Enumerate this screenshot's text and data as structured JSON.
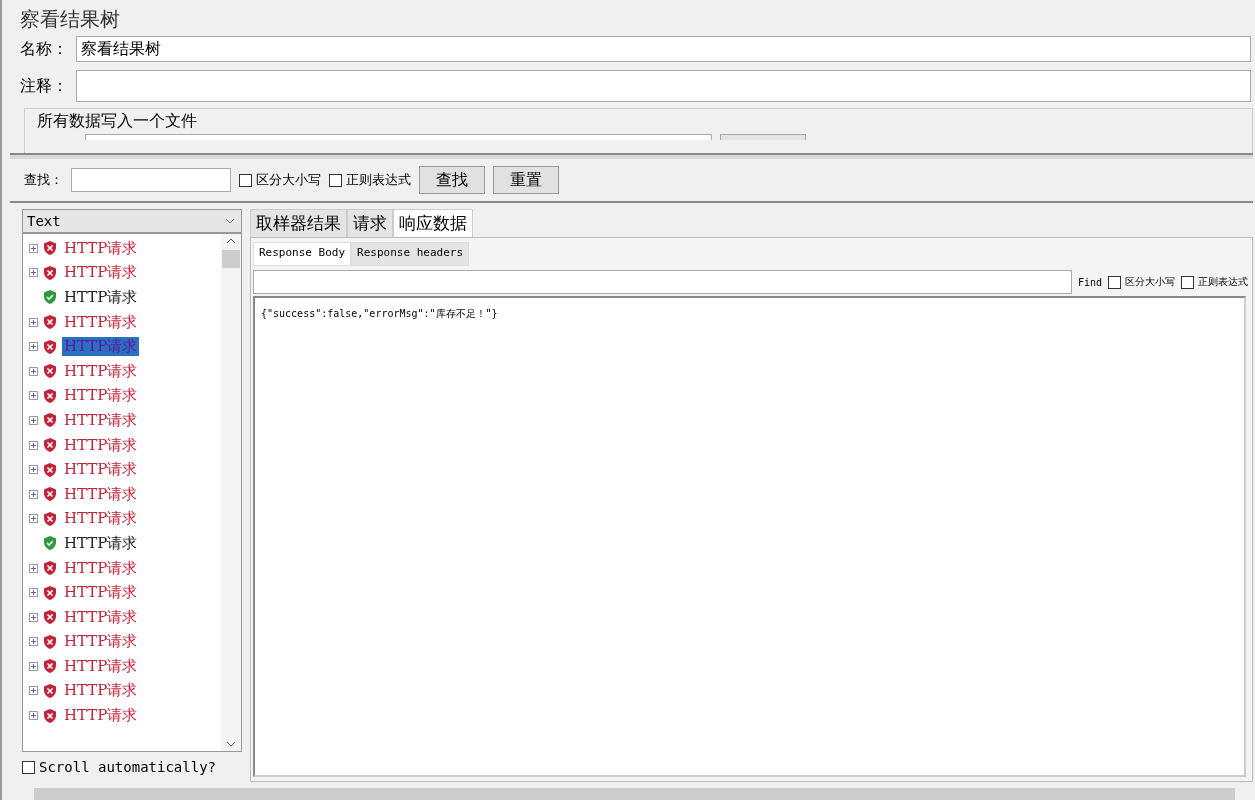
{
  "title": "察看结果树",
  "name_field": {
    "label": "名称：",
    "value": "察看结果树"
  },
  "comment_field": {
    "label": "注释："
  },
  "file_group": {
    "title": "所有数据写入一个文件"
  },
  "search_bar": {
    "label": "查找：",
    "options": [
      {
        "label": "区分大小写",
        "checked": false
      },
      {
        "label": "正则表达式",
        "checked": false
      }
    ],
    "buttons": [
      "查找",
      "重置"
    ]
  },
  "renderer": {
    "value": "Text"
  },
  "tree": [
    {
      "label": "HTTP请求",
      "success": false,
      "selected": false
    },
    {
      "label": "HTTP请求",
      "success": false,
      "selected": false
    },
    {
      "label": "HTTP请求",
      "success": true,
      "selected": false
    },
    {
      "label": "HTTP请求",
      "success": false,
      "selected": false
    },
    {
      "label": "HTTP请求",
      "success": false,
      "selected": true
    },
    {
      "label": "HTTP请求",
      "success": false,
      "selected": false
    },
    {
      "label": "HTTP请求",
      "success": false,
      "selected": false
    },
    {
      "label": "HTTP请求",
      "success": false,
      "selected": false
    },
    {
      "label": "HTTP请求",
      "success": false,
      "selected": false
    },
    {
      "label": "HTTP请求",
      "success": false,
      "selected": false
    },
    {
      "label": "HTTP请求",
      "success": false,
      "selected": false
    },
    {
      "label": "HTTP请求",
      "success": false,
      "selected": false
    },
    {
      "label": "HTTP请求",
      "success": true,
      "selected": false
    },
    {
      "label": "HTTP请求",
      "success": false,
      "selected": false
    },
    {
      "label": "HTTP请求",
      "success": false,
      "selected": false
    },
    {
      "label": "HTTP请求",
      "success": false,
      "selected": false
    },
    {
      "label": "HTTP请求",
      "success": false,
      "selected": false
    },
    {
      "label": "HTTP请求",
      "success": false,
      "selected": false
    },
    {
      "label": "HTTP请求",
      "success": false,
      "selected": false
    },
    {
      "label": "HTTP请求",
      "success": false,
      "selected": false
    }
  ],
  "scroll_auto": {
    "label": "Scroll automatically?",
    "checked": false
  },
  "tabs": [
    {
      "label": "取样器结果",
      "selected": false
    },
    {
      "label": "请求",
      "selected": false
    },
    {
      "label": "响应数据",
      "selected": true
    }
  ],
  "sub_tabs": [
    {
      "label": "Response Body",
      "selected": true
    },
    {
      "label": "Response headers",
      "selected": false
    }
  ],
  "find_bar": {
    "label": "Find",
    "options": [
      {
        "label": "区分大小写",
        "checked": false
      },
      {
        "label": "正则表达式",
        "checked": false
      }
    ]
  },
  "response_body": "{\"success\":false,\"errorMsg\":\"库存不足！\"}"
}
